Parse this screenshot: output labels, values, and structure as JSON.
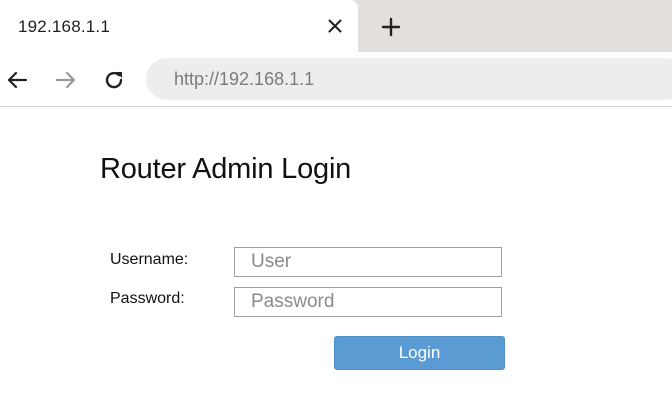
{
  "browser": {
    "tab": {
      "title": "192.168.1.1",
      "close_icon": "close-icon"
    },
    "new_tab_icon": "plus-icon",
    "nav": {
      "back_icon": "arrow-left-icon",
      "forward_icon": "arrow-right-icon",
      "reload_icon": "reload-icon"
    },
    "address_bar": {
      "url": "http://192.168.1.1"
    },
    "colors": {
      "tabstrip_bg": "#e3dfdd",
      "omnibox_bg": "#efedec"
    }
  },
  "login": {
    "title": "Router Admin Login",
    "username": {
      "label": "Username:",
      "placeholder": "User",
      "value": ""
    },
    "password": {
      "label": "Password:",
      "placeholder": "Password",
      "value": ""
    },
    "submit_label": "Login",
    "colors": {
      "button_bg": "#5a9bd3",
      "button_text": "#ffffff"
    }
  }
}
